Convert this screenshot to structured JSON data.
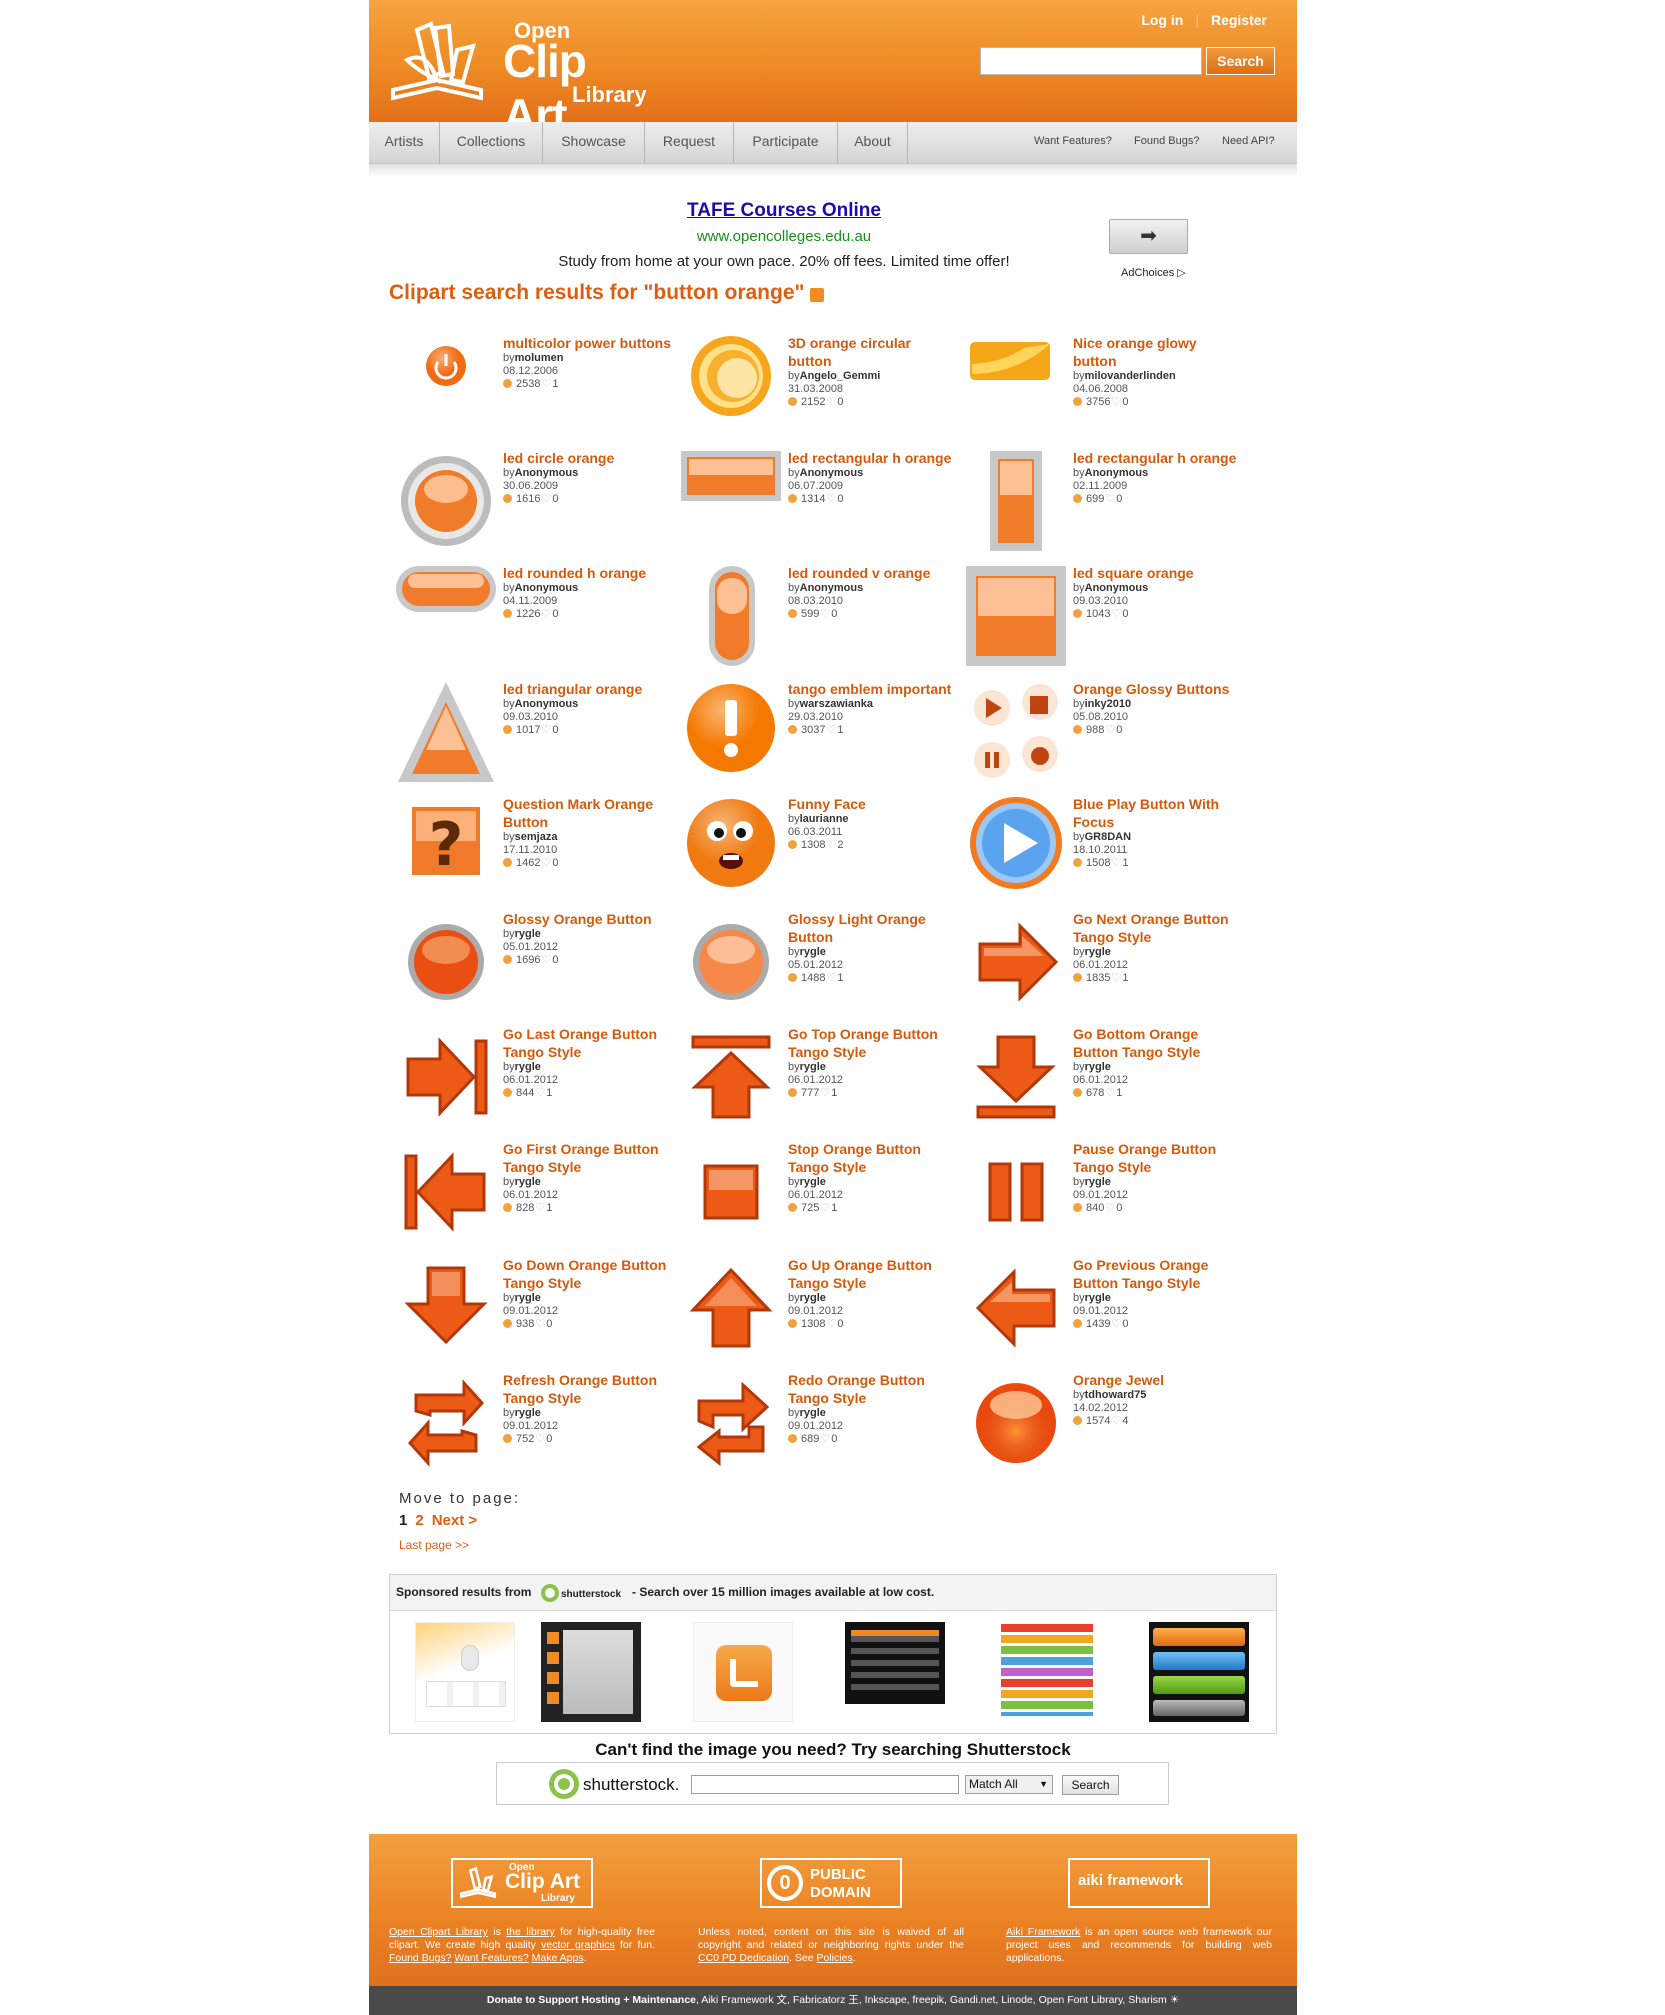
{
  "header": {
    "logo": {
      "line1": "Open",
      "line2": "Clip Art",
      "line3": "Library"
    },
    "login": "Log in",
    "separator": "|",
    "register": "Register",
    "search_button": "Search",
    "search_value": ""
  },
  "nav": {
    "items": [
      "Artists",
      "Collections",
      "Showcase",
      "Request",
      "Participate",
      "About"
    ],
    "right": [
      "Want Features?",
      "Found Bugs?",
      "Need API?"
    ]
  },
  "ad": {
    "title": "TAFE Courses Online",
    "url": "www.opencolleges.edu.au",
    "description": "Study from home at your own pace. 20% off fees. Limited time offer!",
    "choices": "AdChoices ▷"
  },
  "results_title": "Clipart search results for \"button orange\"",
  "by_label": "by",
  "results": [
    {
      "name": "multicolor power buttons",
      "author": "molumen",
      "date": "08.12.2006",
      "downloads": "2538",
      "likes": "1",
      "icon": "power-button-icon"
    },
    {
      "name": "3D orange circular button",
      "author": "Angelo_Gemmi",
      "date": "31.03.2008",
      "downloads": "2152",
      "likes": "0",
      "icon": "circular-button-icon"
    },
    {
      "name": "Nice orange glowy button",
      "author": "milovanderlinden",
      "date": "04.06.2008",
      "downloads": "3756",
      "likes": "0",
      "icon": "glowy-button-icon"
    },
    {
      "name": "led circle orange",
      "author": "Anonymous",
      "date": "30.06.2009",
      "downloads": "1616",
      "likes": "0",
      "icon": "led-circle-icon"
    },
    {
      "name": "led rectangular h orange",
      "author": "Anonymous",
      "date": "06.07.2009",
      "downloads": "1314",
      "likes": "0",
      "icon": "led-rect-h-icon"
    },
    {
      "name": "led rectangular h orange",
      "author": "Anonymous",
      "date": "02.11.2009",
      "downloads": "699",
      "likes": "0",
      "icon": "led-rect-v-icon"
    },
    {
      "name": "led rounded h orange",
      "author": "Anonymous",
      "date": "04.11.2009",
      "downloads": "1226",
      "likes": "0",
      "icon": "led-rounded-h-icon"
    },
    {
      "name": "led rounded v orange",
      "author": "Anonymous",
      "date": "08.03.2010",
      "downloads": "599",
      "likes": "0",
      "icon": "led-rounded-v-icon"
    },
    {
      "name": "led square orange",
      "author": "Anonymous",
      "date": "09.03.2010",
      "downloads": "1043",
      "likes": "0",
      "icon": "led-square-icon"
    },
    {
      "name": "led triangular orange",
      "author": "Anonymous",
      "date": "09.03.2010",
      "downloads": "1017",
      "likes": "0",
      "icon": "led-triangle-icon"
    },
    {
      "name": "tango emblem important",
      "author": "warszawianka",
      "date": "29.03.2010",
      "downloads": "3037",
      "likes": "1",
      "icon": "emblem-important-icon"
    },
    {
      "name": "Orange Glossy Buttons",
      "author": "inky2010",
      "date": "05.08.2010",
      "downloads": "988",
      "likes": "0",
      "icon": "glossy-buttons-icon"
    },
    {
      "name": "Question Mark Orange Button",
      "author": "semjaza",
      "date": "17.11.2010",
      "downloads": "1462",
      "likes": "0",
      "icon": "question-mark-icon"
    },
    {
      "name": "Funny Face",
      "author": "laurianne",
      "date": "06.03.2011",
      "downloads": "1308",
      "likes": "2",
      "icon": "funny-face-icon"
    },
    {
      "name": "Blue Play Button With Focus",
      "author": "GR8DAN",
      "date": "18.10.2011",
      "downloads": "1508",
      "likes": "1",
      "icon": "play-button-icon"
    },
    {
      "name": "Glossy Orange Button",
      "author": "rygle",
      "date": "05.01.2012",
      "downloads": "1696",
      "likes": "0",
      "icon": "glossy-orange-icon"
    },
    {
      "name": "Glossy Light Orange Button",
      "author": "rygle",
      "date": "05.01.2012",
      "downloads": "1488",
      "likes": "1",
      "icon": "glossy-light-icon"
    },
    {
      "name": "Go Next Orange Button Tango Style",
      "author": "rygle",
      "date": "06.01.2012",
      "downloads": "1835",
      "likes": "1",
      "icon": "go-next-icon"
    },
    {
      "name": "Go Last Orange Button Tango Style",
      "author": "rygle",
      "date": "06.01.2012",
      "downloads": "844",
      "likes": "1",
      "icon": "go-last-icon"
    },
    {
      "name": "Go Top Orange Button Tango Style",
      "author": "rygle",
      "date": "06.01.2012",
      "downloads": "777",
      "likes": "1",
      "icon": "go-top-icon"
    },
    {
      "name": "Go Bottom Orange Button Tango Style",
      "author": "rygle",
      "date": "06.01.2012",
      "downloads": "678",
      "likes": "1",
      "icon": "go-bottom-icon"
    },
    {
      "name": "Go First Orange Button Tango Style",
      "author": "rygle",
      "date": "06.01.2012",
      "downloads": "828",
      "likes": "1",
      "icon": "go-first-icon"
    },
    {
      "name": "Stop Orange Button Tango Style",
      "author": "rygle",
      "date": "06.01.2012",
      "downloads": "725",
      "likes": "1",
      "icon": "stop-icon"
    },
    {
      "name": "Pause Orange Button Tango Style",
      "author": "rygle",
      "date": "09.01.2012",
      "downloads": "840",
      "likes": "0",
      "icon": "pause-icon"
    },
    {
      "name": "Go Down Orange Button Tango Style",
      "author": "rygle",
      "date": "09.01.2012",
      "downloads": "938",
      "likes": "0",
      "icon": "go-down-icon"
    },
    {
      "name": "Go Up Orange Button Tango Style",
      "author": "rygle",
      "date": "09.01.2012",
      "downloads": "1308",
      "likes": "0",
      "icon": "go-up-icon"
    },
    {
      "name": "Go Previous Orange Button Tango Style",
      "author": "rygle",
      "date": "09.01.2012",
      "downloads": "1439",
      "likes": "0",
      "icon": "go-previous-icon"
    },
    {
      "name": "Refresh Orange Button Tango Style",
      "author": "rygle",
      "date": "09.01.2012",
      "downloads": "752",
      "likes": "0",
      "icon": "refresh-icon"
    },
    {
      "name": "Redo Orange Button Tango Style",
      "author": "rygle",
      "date": "09.01.2012",
      "downloads": "689",
      "likes": "0",
      "icon": "redo-icon"
    },
    {
      "name": "Orange Jewel",
      "author": "tdhoward75",
      "date": "14.02.2012",
      "downloads": "1574",
      "likes": "4",
      "icon": "orange-jewel-icon"
    }
  ],
  "pagination": {
    "label": "Move to page:",
    "current": "1",
    "page2": "2",
    "next": "Next >",
    "last": "Last page >>"
  },
  "sponsored": {
    "prefix": "Sponsored results from",
    "logo_text": "shutterstock",
    "suffix": "- Search over 15 million images available at low cost."
  },
  "shutterstock_search": {
    "heading": "Can't find the image you need? Try searching Shutterstock",
    "logo_text": "shutterstock.",
    "select_value": "Match All",
    "button": "Search"
  },
  "footer": {
    "col1_badge": {
      "line1": "Open",
      "line2": "Clip Art",
      "line3": "Library"
    },
    "col2_badge": {
      "line1": "PUBLIC",
      "line2": "DOMAIN"
    },
    "col3_badge": "aiki framework",
    "col1_parts": [
      "Open Clipart Library",
      " is ",
      "the library",
      " for high-quality free clipart. We create high quality ",
      "vector graphics",
      " for fun. ",
      "Found Bugs?",
      " ",
      "Want Features?",
      " ",
      "Make Apps",
      "."
    ],
    "col2_parts": [
      "Unless noted, content on this site is waived of all copyright and related or neighboring rights under the ",
      "CC0 PD Dedication",
      ". See ",
      "Policies",
      "."
    ],
    "col3_parts": [
      "Aiki Framework",
      " is an open source web framework our project uses and recommends for building web applications."
    ],
    "bottom_bold": "Donate to Support Hosting + Maintenance",
    "bottom_rest": ", Aiki Framework 文, Fabricatorz 王, Inkscape, freepik, Gandi.net, Linode, Open Font Library, Sharism ☀"
  },
  "colors": {
    "brand_orange": "#ee8a24",
    "link_orange": "#d45a0c",
    "ad_link": "#1a0dab",
    "ad_url": "#1a8f1a",
    "footer_bar": "#4a4a4a"
  }
}
